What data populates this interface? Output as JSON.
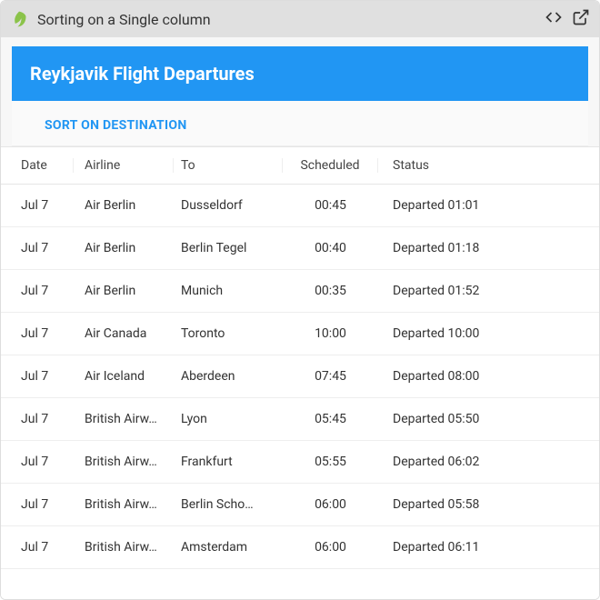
{
  "window": {
    "title": "Sorting on a Single column"
  },
  "header": {
    "title": "Reykjavik Flight Departures"
  },
  "sortbar": {
    "label": "SORT ON DESTINATION"
  },
  "columns": {
    "date": "Date",
    "airline": "Airline",
    "to": "To",
    "scheduled": "Scheduled",
    "status": "Status"
  },
  "rows": [
    {
      "date": "Jul 7",
      "airline": "Air Berlin",
      "to": "Dusseldorf",
      "scheduled": "00:45",
      "status": "Departed 01:01"
    },
    {
      "date": "Jul 7",
      "airline": "Air Berlin",
      "to": "Berlin Tegel",
      "scheduled": "00:40",
      "status": "Departed 01:18"
    },
    {
      "date": "Jul 7",
      "airline": "Air Berlin",
      "to": "Munich",
      "scheduled": "00:35",
      "status": "Departed 01:52"
    },
    {
      "date": "Jul 7",
      "airline": "Air Canada",
      "to": "Toronto",
      "scheduled": "10:00",
      "status": "Departed 10:00"
    },
    {
      "date": "Jul 7",
      "airline": "Air Iceland",
      "to": "Aberdeen",
      "scheduled": "07:45",
      "status": "Departed 08:00"
    },
    {
      "date": "Jul 7",
      "airline": "British Airw…",
      "to": "Lyon",
      "scheduled": "05:45",
      "status": "Departed 05:50"
    },
    {
      "date": "Jul 7",
      "airline": "British Airw…",
      "to": "Frankfurt",
      "scheduled": "05:55",
      "status": "Departed 06:02"
    },
    {
      "date": "Jul 7",
      "airline": "British Airw…",
      "to": "Berlin Scho…",
      "scheduled": "06:00",
      "status": "Departed 05:58"
    },
    {
      "date": "Jul 7",
      "airline": "British Airw…",
      "to": "Amsterdam",
      "scheduled": "06:00",
      "status": "Departed 06:11"
    }
  ]
}
